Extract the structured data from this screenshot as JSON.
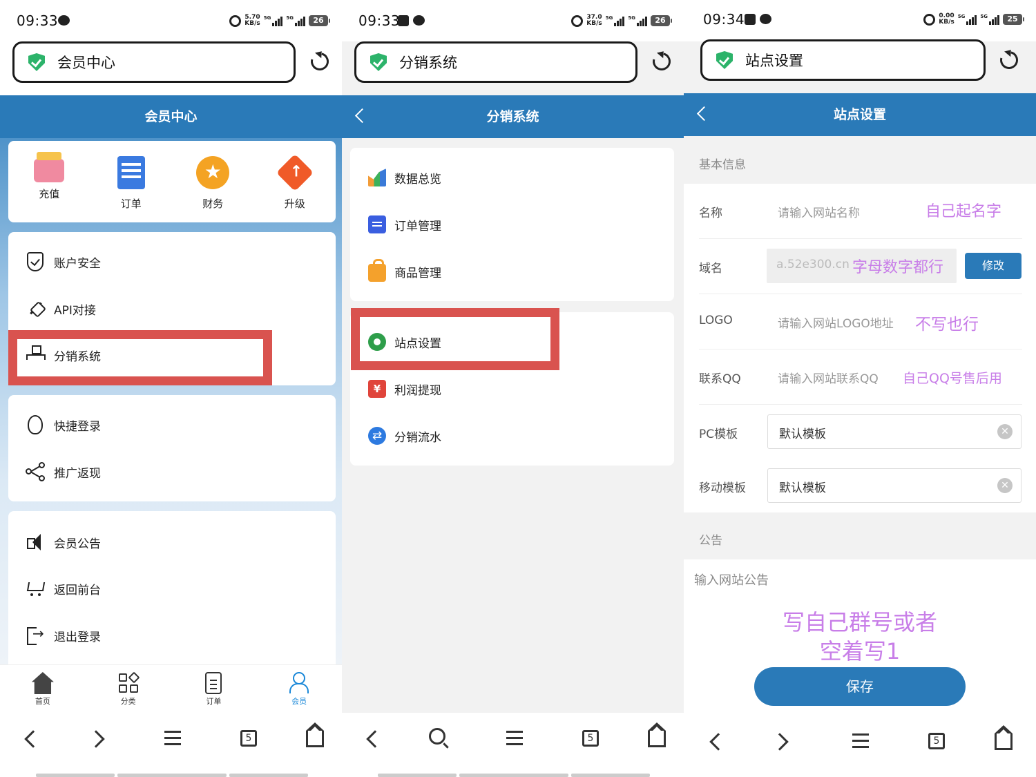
{
  "panels": [
    {
      "status": {
        "time": "09:33",
        "speed_top": "5.70",
        "speed_bottom": "KB/s",
        "battery": "26",
        "net": "5G"
      },
      "url": "会员中心",
      "header_title": "会员中心",
      "quick": [
        {
          "label": "充值",
          "icon": "recharge-icon"
        },
        {
          "label": "订单",
          "icon": "order-icon"
        },
        {
          "label": "财务",
          "icon": "finance-icon"
        },
        {
          "label": "升级",
          "icon": "upgrade-icon"
        }
      ],
      "menu_group1": [
        "账户安全",
        "API对接",
        "分销系统"
      ],
      "menu_group2": [
        "快捷登录",
        "推广返现"
      ],
      "menu_group3": [
        "会员公告",
        "返回前台",
        "退出登录"
      ],
      "tabs": [
        "首页",
        "分类",
        "订单",
        "会员"
      ],
      "nav_tab_count": "5"
    },
    {
      "status": {
        "time": "09:33",
        "speed_top": "37.0",
        "speed_bottom": "KB/s",
        "battery": "26",
        "net": "5G"
      },
      "url": "分销系统",
      "header_title": "分销系统",
      "list_group1": [
        "数据总览",
        "订单管理",
        "商品管理"
      ],
      "list_group2": [
        "站点设置",
        "利润提现",
        "分销流水"
      ],
      "nav_tab_count": "5"
    },
    {
      "status": {
        "time": "09:34",
        "speed_top": "0.00",
        "speed_bottom": "KB/s",
        "battery": "25",
        "net": "5G"
      },
      "url": "站点设置",
      "header_title": "站点设置",
      "section_basic": "基本信息",
      "fields": {
        "name": {
          "label": "名称",
          "placeholder": "请输入网站名称",
          "annotation": "自己起名字"
        },
        "domain": {
          "label": "域名",
          "value": "a.52e300.cn",
          "annotation": "字母数字都行",
          "button": "修改"
        },
        "logo": {
          "label": "LOGO",
          "placeholder": "请输入网站LOGO地址",
          "annotation": "不写也行"
        },
        "qq": {
          "label": "联系QQ",
          "placeholder": "请输入网站联系QQ",
          "annotation": "自己QQ号售后用"
        },
        "pc_template": {
          "label": "PC模板",
          "value": "默认模板"
        },
        "mobile_template": {
          "label": "移动模板",
          "value": "默认模板"
        }
      },
      "section_notice": "公告",
      "notice_placeholder": "输入网站公告",
      "notice_annotation_line1": "写自己群号或者",
      "notice_annotation_line2": "空着写1",
      "save_label": "保存",
      "nav_tab_count": "5"
    }
  ],
  "colors": {
    "header": "#2a7ab8",
    "highlight": "#d9534f",
    "annotation": "#c87ee8",
    "secure": "#2cb36a"
  }
}
